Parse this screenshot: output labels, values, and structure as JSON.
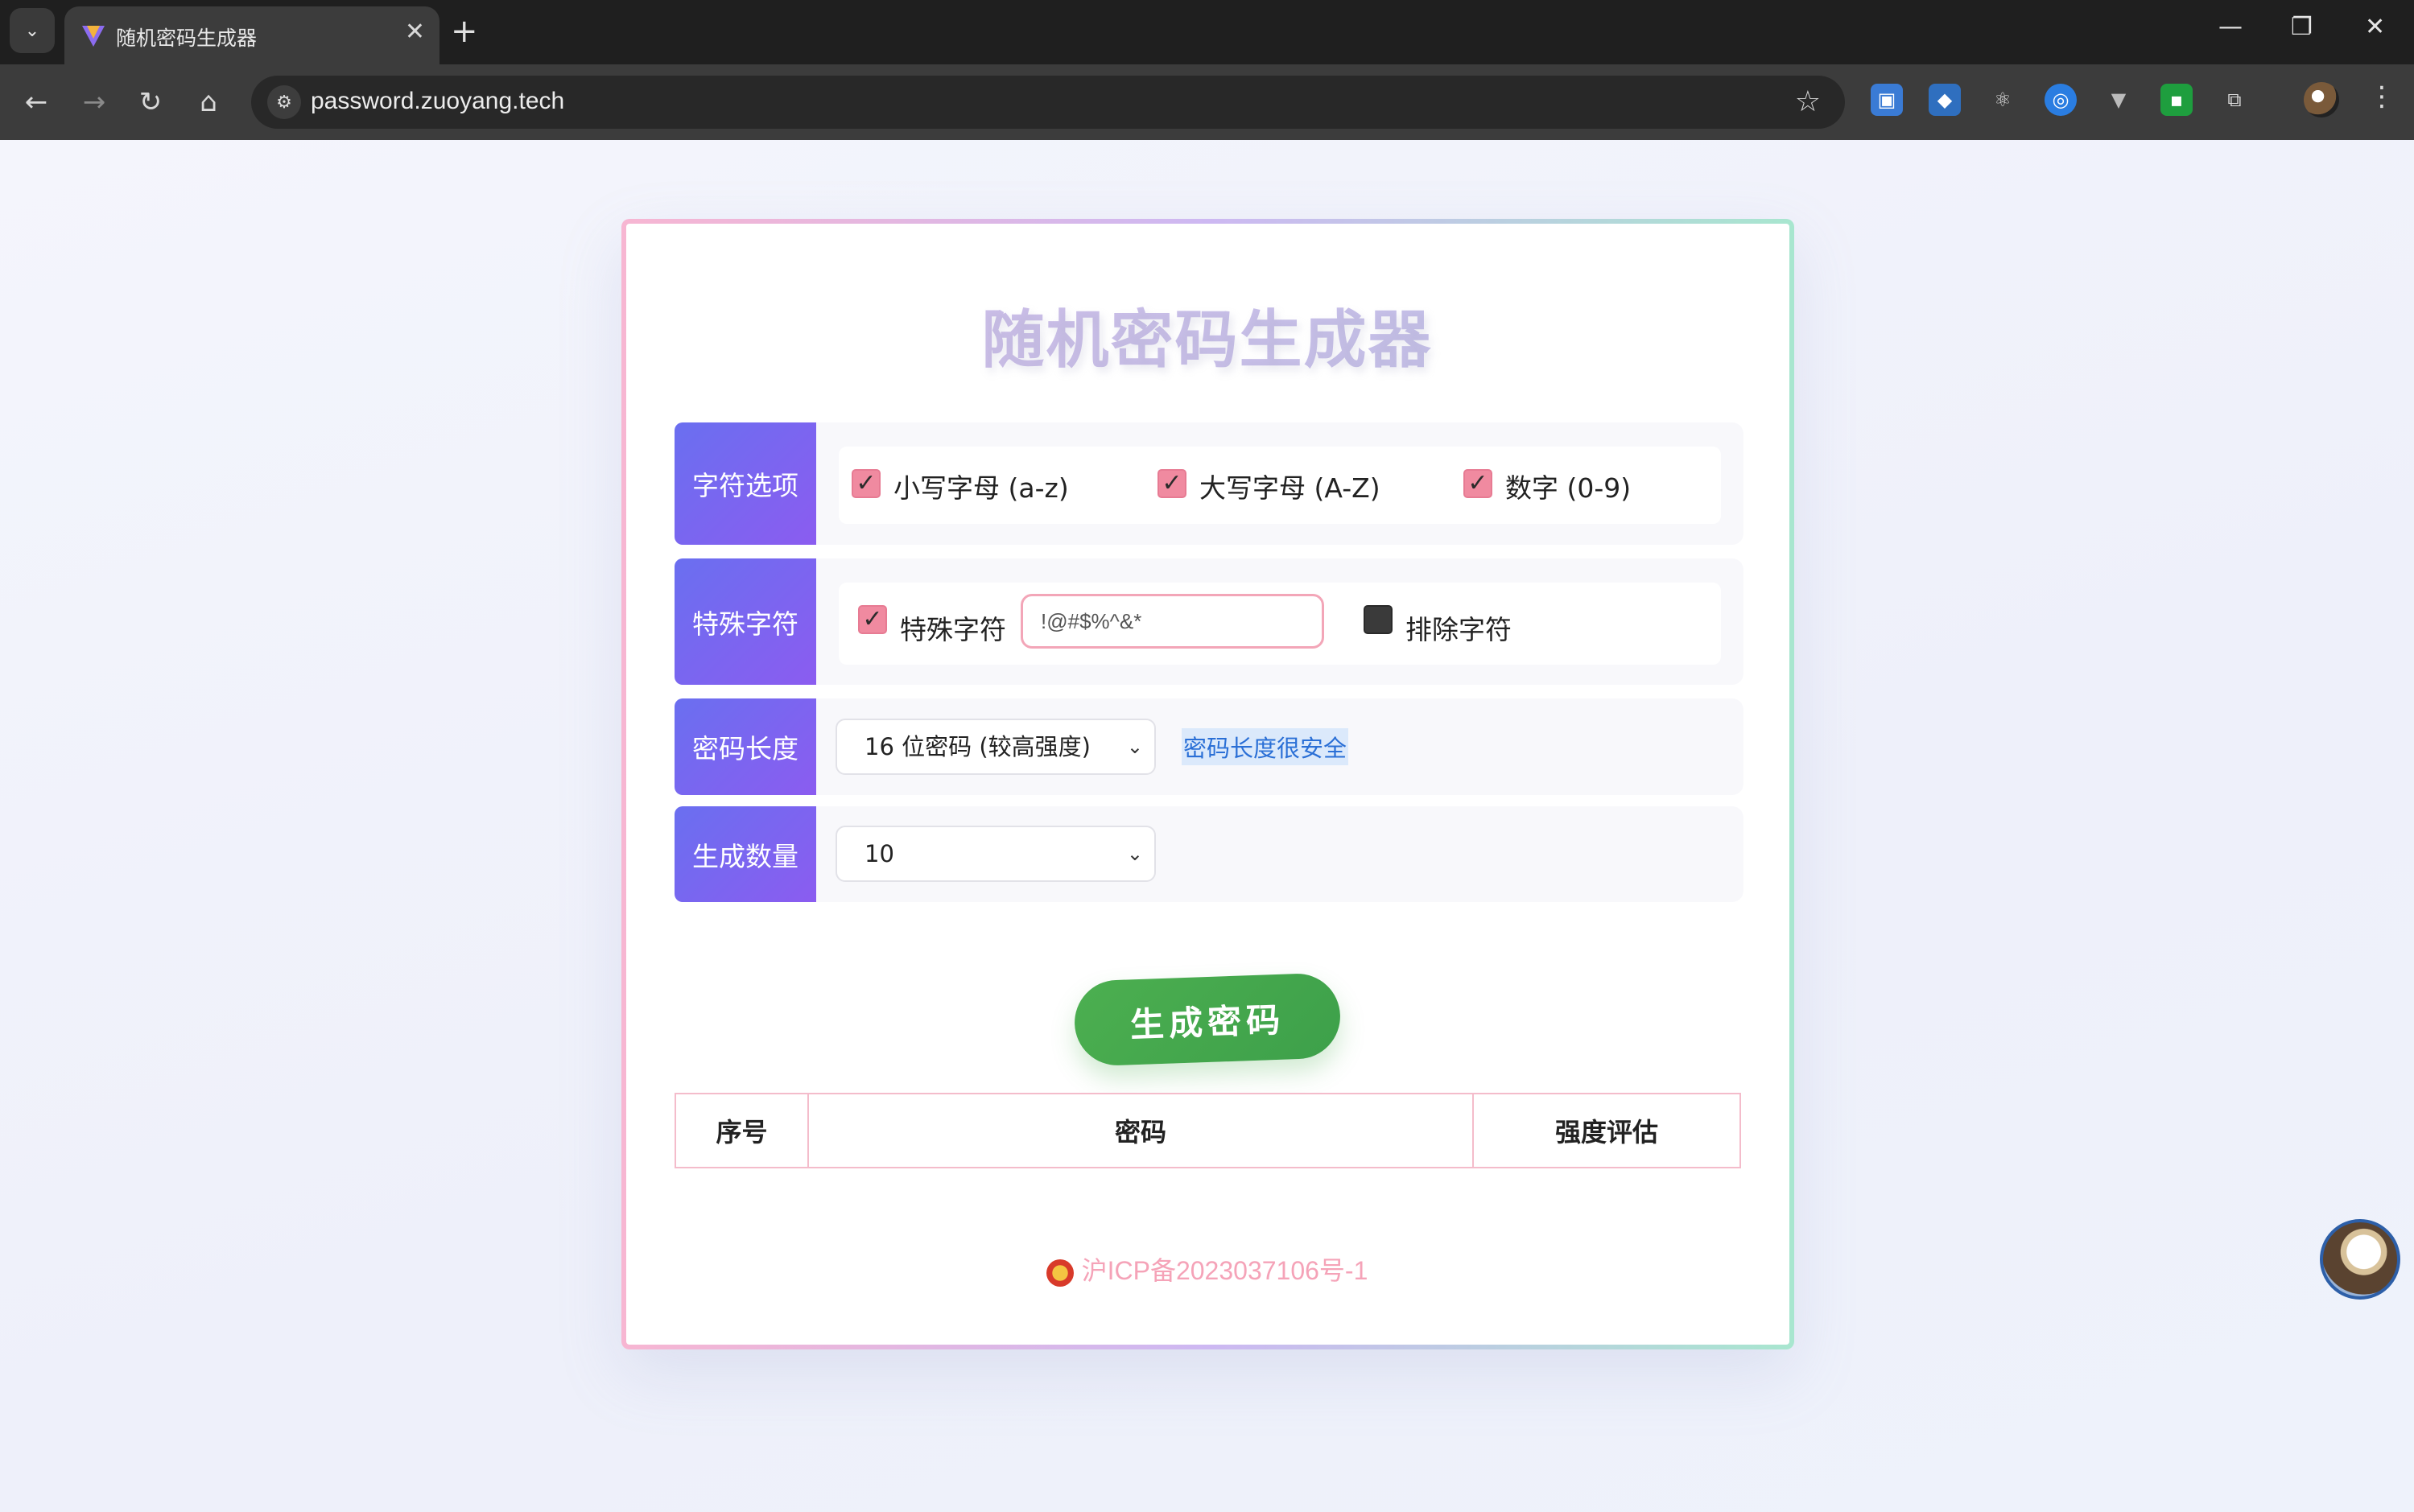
{
  "browser": {
    "tab_title": "随机密码生成器",
    "tab_close": "✕",
    "new_tab": "+",
    "url": "password.zuoyang.tech",
    "window_controls": {
      "minimize": "—",
      "restore": "❐",
      "close": "✕"
    }
  },
  "page": {
    "title": "随机密码生成器",
    "rows": {
      "char_options": {
        "label": "字符选项",
        "lowercase": {
          "label": "小写字母 (a-z)",
          "checked": true
        },
        "uppercase": {
          "label": "大写字母 (A-Z)",
          "checked": true
        },
        "digits": {
          "label": "数字 (0-9)",
          "checked": true
        }
      },
      "special_chars": {
        "label": "特殊字符",
        "special": {
          "label": "特殊字符",
          "checked": true
        },
        "input_value": "!@#$%^&*",
        "exclude": {
          "label": "排除字符",
          "checked": false
        }
      },
      "length": {
        "label": "密码长度",
        "selected": "16 位密码 (较高强度)",
        "hint": "密码长度很安全"
      },
      "count": {
        "label": "生成数量",
        "selected": "10"
      }
    },
    "generate_button": "生成密码",
    "table_headers": [
      "序号",
      "密码",
      "强度评估"
    ],
    "footer": "沪ICP备2023037106号-1"
  },
  "colors": {
    "label_gradient": [
      "#6a6ff0",
      "#8b5cf0"
    ],
    "checkbox": "#f08aa0",
    "button": "#4caf50",
    "footer_text": "#f5a3b8",
    "hint_text": "#2a6fd6"
  },
  "icons": [
    "tab-search-icon",
    "favicon-icon",
    "close-icon",
    "plus-icon",
    "back-icon",
    "forward-icon",
    "reload-icon",
    "home-icon",
    "site-info-icon",
    "star-icon",
    "puzzle-icon",
    "menu-icon",
    "chevron-down-icon",
    "check-icon",
    "emblem-icon"
  ]
}
